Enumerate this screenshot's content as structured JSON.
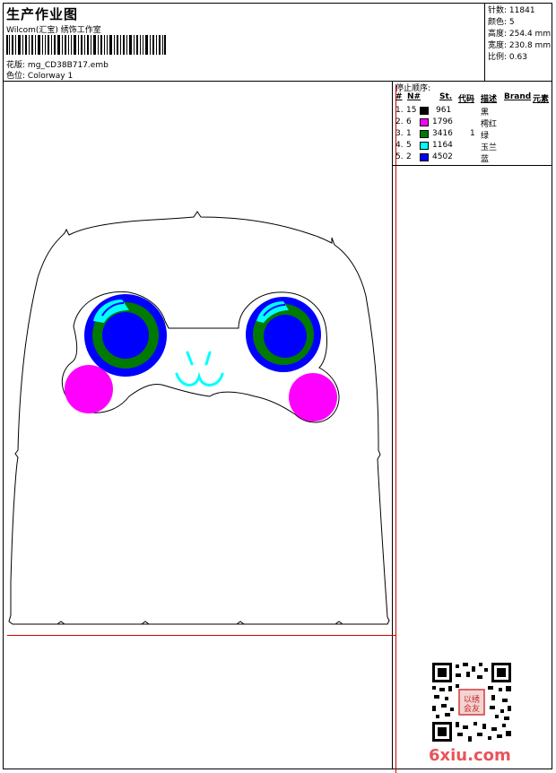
{
  "header": {
    "title": "生产作业图",
    "subtitle": "Wilcom(汇宝) 绣饰工作室",
    "design_label": "花版:",
    "design_value": "mg_CD38B717.emb",
    "colorway_label": "色位:",
    "colorway_value": "Colorway 1"
  },
  "stats": [
    {
      "label": "针数:",
      "value": "11841"
    },
    {
      "label": "颜色:",
      "value": "5"
    },
    {
      "label": "高度:",
      "value": "254.4 mm"
    },
    {
      "label": "宽度:",
      "value": "230.8 mm"
    },
    {
      "label": "比例:",
      "value": "0.63"
    }
  ],
  "color_table": {
    "stop_label": "停止顺序:",
    "headers": {
      "num": "#",
      "n": "N#",
      "st": "St.",
      "code": "代码",
      "desc": "描述",
      "brand": "Brand",
      "elem": "元素"
    },
    "rows": [
      {
        "idx": "1.",
        "n": "15",
        "color": "#000000",
        "st": "961",
        "code": "",
        "desc": "黑"
      },
      {
        "idx": "2.",
        "n": "6",
        "color": "#ff00ff",
        "st": "1796",
        "code": "",
        "desc": "樗红"
      },
      {
        "idx": "3.",
        "n": "1",
        "color": "#007a00",
        "st": "3416",
        "code": "1",
        "desc": "绿"
      },
      {
        "idx": "4.",
        "n": "5",
        "color": "#00ffff",
        "st": "1164",
        "code": "",
        "desc": "玉兰"
      },
      {
        "idx": "5.",
        "n": "2",
        "color": "#0000ff",
        "st": "4502",
        "code": "",
        "desc": "蓝"
      }
    ]
  },
  "watermark": {
    "site": "6xiu.com",
    "seal_text": "以绣会友"
  }
}
